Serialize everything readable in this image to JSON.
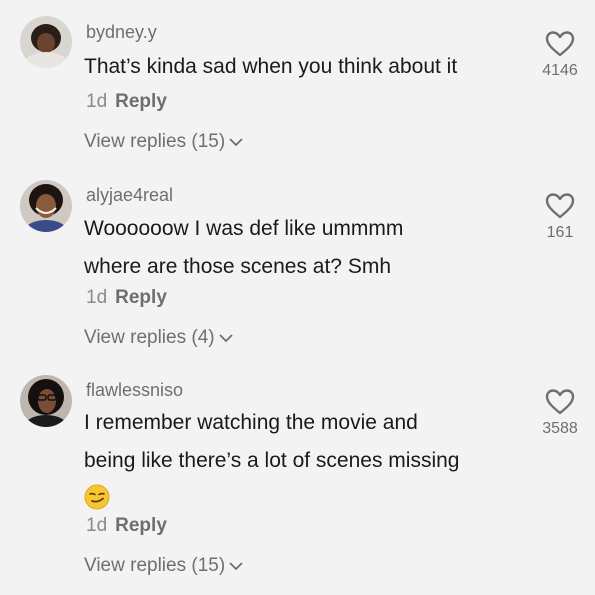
{
  "comments": [
    {
      "username": "bydney.y",
      "lines": [
        "That’s kinda sad when you think about it"
      ],
      "time": "1d",
      "reply_label": "Reply",
      "view_replies": "View replies (15)",
      "likes": "4146",
      "avatar_color": "#3a2a22"
    },
    {
      "username": "alyjae4real",
      "lines": [
        "Woooooow I was def like ummmm",
        "where are those scenes at? Smh"
      ],
      "time": "1d",
      "reply_label": "Reply",
      "view_replies": "View replies (4)",
      "likes": "161",
      "avatar_color": "#5a3a28"
    },
    {
      "username": "flawlessniso",
      "lines": [
        "I remember watching the movie and",
        "being like there’s a lot of scenes missing"
      ],
      "emoji": "smirking-face",
      "time": "1d",
      "reply_label": "Reply",
      "view_replies": "View replies (15)",
      "likes": "3588",
      "avatar_color": "#2a1e1c"
    }
  ],
  "colors": {
    "background": "#f3f3f3",
    "username": "#6f6f73",
    "text": "#1a1a1d",
    "muted": "#8a8a8e"
  }
}
